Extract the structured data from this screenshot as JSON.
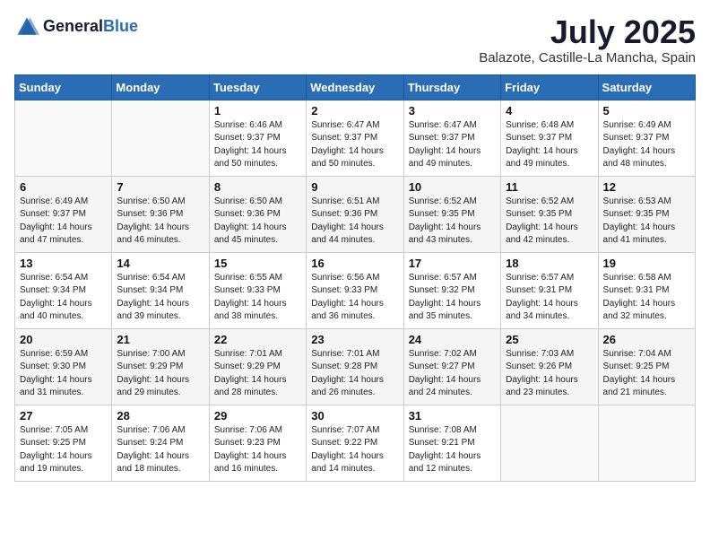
{
  "header": {
    "logo_general": "General",
    "logo_blue": "Blue",
    "month_title": "July 2025",
    "location": "Balazote, Castille-La Mancha, Spain"
  },
  "weekdays": [
    "Sunday",
    "Monday",
    "Tuesday",
    "Wednesday",
    "Thursday",
    "Friday",
    "Saturday"
  ],
  "weeks": [
    [
      {
        "day": "",
        "sunrise": "",
        "sunset": "",
        "daylight": ""
      },
      {
        "day": "",
        "sunrise": "",
        "sunset": "",
        "daylight": ""
      },
      {
        "day": "1",
        "sunrise": "Sunrise: 6:46 AM",
        "sunset": "Sunset: 9:37 PM",
        "daylight": "Daylight: 14 hours and 50 minutes."
      },
      {
        "day": "2",
        "sunrise": "Sunrise: 6:47 AM",
        "sunset": "Sunset: 9:37 PM",
        "daylight": "Daylight: 14 hours and 50 minutes."
      },
      {
        "day": "3",
        "sunrise": "Sunrise: 6:47 AM",
        "sunset": "Sunset: 9:37 PM",
        "daylight": "Daylight: 14 hours and 49 minutes."
      },
      {
        "day": "4",
        "sunrise": "Sunrise: 6:48 AM",
        "sunset": "Sunset: 9:37 PM",
        "daylight": "Daylight: 14 hours and 49 minutes."
      },
      {
        "day": "5",
        "sunrise": "Sunrise: 6:49 AM",
        "sunset": "Sunset: 9:37 PM",
        "daylight": "Daylight: 14 hours and 48 minutes."
      }
    ],
    [
      {
        "day": "6",
        "sunrise": "Sunrise: 6:49 AM",
        "sunset": "Sunset: 9:37 PM",
        "daylight": "Daylight: 14 hours and 47 minutes."
      },
      {
        "day": "7",
        "sunrise": "Sunrise: 6:50 AM",
        "sunset": "Sunset: 9:36 PM",
        "daylight": "Daylight: 14 hours and 46 minutes."
      },
      {
        "day": "8",
        "sunrise": "Sunrise: 6:50 AM",
        "sunset": "Sunset: 9:36 PM",
        "daylight": "Daylight: 14 hours and 45 minutes."
      },
      {
        "day": "9",
        "sunrise": "Sunrise: 6:51 AM",
        "sunset": "Sunset: 9:36 PM",
        "daylight": "Daylight: 14 hours and 44 minutes."
      },
      {
        "day": "10",
        "sunrise": "Sunrise: 6:52 AM",
        "sunset": "Sunset: 9:35 PM",
        "daylight": "Daylight: 14 hours and 43 minutes."
      },
      {
        "day": "11",
        "sunrise": "Sunrise: 6:52 AM",
        "sunset": "Sunset: 9:35 PM",
        "daylight": "Daylight: 14 hours and 42 minutes."
      },
      {
        "day": "12",
        "sunrise": "Sunrise: 6:53 AM",
        "sunset": "Sunset: 9:35 PM",
        "daylight": "Daylight: 14 hours and 41 minutes."
      }
    ],
    [
      {
        "day": "13",
        "sunrise": "Sunrise: 6:54 AM",
        "sunset": "Sunset: 9:34 PM",
        "daylight": "Daylight: 14 hours and 40 minutes."
      },
      {
        "day": "14",
        "sunrise": "Sunrise: 6:54 AM",
        "sunset": "Sunset: 9:34 PM",
        "daylight": "Daylight: 14 hours and 39 minutes."
      },
      {
        "day": "15",
        "sunrise": "Sunrise: 6:55 AM",
        "sunset": "Sunset: 9:33 PM",
        "daylight": "Daylight: 14 hours and 38 minutes."
      },
      {
        "day": "16",
        "sunrise": "Sunrise: 6:56 AM",
        "sunset": "Sunset: 9:33 PM",
        "daylight": "Daylight: 14 hours and 36 minutes."
      },
      {
        "day": "17",
        "sunrise": "Sunrise: 6:57 AM",
        "sunset": "Sunset: 9:32 PM",
        "daylight": "Daylight: 14 hours and 35 minutes."
      },
      {
        "day": "18",
        "sunrise": "Sunrise: 6:57 AM",
        "sunset": "Sunset: 9:31 PM",
        "daylight": "Daylight: 14 hours and 34 minutes."
      },
      {
        "day": "19",
        "sunrise": "Sunrise: 6:58 AM",
        "sunset": "Sunset: 9:31 PM",
        "daylight": "Daylight: 14 hours and 32 minutes."
      }
    ],
    [
      {
        "day": "20",
        "sunrise": "Sunrise: 6:59 AM",
        "sunset": "Sunset: 9:30 PM",
        "daylight": "Daylight: 14 hours and 31 minutes."
      },
      {
        "day": "21",
        "sunrise": "Sunrise: 7:00 AM",
        "sunset": "Sunset: 9:29 PM",
        "daylight": "Daylight: 14 hours and 29 minutes."
      },
      {
        "day": "22",
        "sunrise": "Sunrise: 7:01 AM",
        "sunset": "Sunset: 9:29 PM",
        "daylight": "Daylight: 14 hours and 28 minutes."
      },
      {
        "day": "23",
        "sunrise": "Sunrise: 7:01 AM",
        "sunset": "Sunset: 9:28 PM",
        "daylight": "Daylight: 14 hours and 26 minutes."
      },
      {
        "day": "24",
        "sunrise": "Sunrise: 7:02 AM",
        "sunset": "Sunset: 9:27 PM",
        "daylight": "Daylight: 14 hours and 24 minutes."
      },
      {
        "day": "25",
        "sunrise": "Sunrise: 7:03 AM",
        "sunset": "Sunset: 9:26 PM",
        "daylight": "Daylight: 14 hours and 23 minutes."
      },
      {
        "day": "26",
        "sunrise": "Sunrise: 7:04 AM",
        "sunset": "Sunset: 9:25 PM",
        "daylight": "Daylight: 14 hours and 21 minutes."
      }
    ],
    [
      {
        "day": "27",
        "sunrise": "Sunrise: 7:05 AM",
        "sunset": "Sunset: 9:25 PM",
        "daylight": "Daylight: 14 hours and 19 minutes."
      },
      {
        "day": "28",
        "sunrise": "Sunrise: 7:06 AM",
        "sunset": "Sunset: 9:24 PM",
        "daylight": "Daylight: 14 hours and 18 minutes."
      },
      {
        "day": "29",
        "sunrise": "Sunrise: 7:06 AM",
        "sunset": "Sunset: 9:23 PM",
        "daylight": "Daylight: 14 hours and 16 minutes."
      },
      {
        "day": "30",
        "sunrise": "Sunrise: 7:07 AM",
        "sunset": "Sunset: 9:22 PM",
        "daylight": "Daylight: 14 hours and 14 minutes."
      },
      {
        "day": "31",
        "sunrise": "Sunrise: 7:08 AM",
        "sunset": "Sunset: 9:21 PM",
        "daylight": "Daylight: 14 hours and 12 minutes."
      },
      {
        "day": "",
        "sunrise": "",
        "sunset": "",
        "daylight": ""
      },
      {
        "day": "",
        "sunrise": "",
        "sunset": "",
        "daylight": ""
      }
    ]
  ]
}
